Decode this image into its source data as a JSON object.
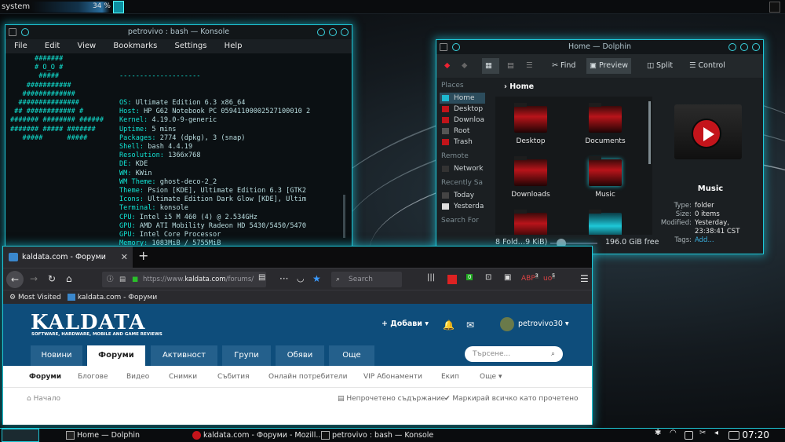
{
  "topbar": {
    "system_label": "system",
    "cpu_percent": "34 %"
  },
  "konsole": {
    "title": "petrovivo : bash — Konsole",
    "menu": [
      "File",
      "Edit",
      "View",
      "Bookmarks",
      "Settings",
      "Help"
    ],
    "logo_lines": [
      "      #######",
      "      # O_O #",
      "       #####",
      "    ###########",
      "   #############",
      "  ###############",
      " ## ############ #",
      "####### ######## ######",
      "####### ##### #######",
      "   #####      #####"
    ],
    "separator": "--------------------",
    "info": [
      {
        "k": "OS:",
        "v": "Ultimate Edition 6.3 x86_64"
      },
      {
        "k": "Host:",
        "v": "HP G62 Notebook PC 05941100002527100010 2"
      },
      {
        "k": "Kernel:",
        "v": "4.19.0-9-generic"
      },
      {
        "k": "Uptime:",
        "v": "5 mins"
      },
      {
        "k": "Packages:",
        "v": "2774 (dpkg), 3 (snap)"
      },
      {
        "k": "Shell:",
        "v": "bash 4.4.19"
      },
      {
        "k": "Resolution:",
        "v": "1366x768"
      },
      {
        "k": "DE:",
        "v": "KDE"
      },
      {
        "k": "WM:",
        "v": "KWin"
      },
      {
        "k": "WM Theme:",
        "v": "ghost-deco-2_2"
      },
      {
        "k": "Theme:",
        "v": "Psion [KDE], Ultimate Edition 6.3 [GTK2"
      },
      {
        "k": "Icons:",
        "v": "Ultimate Edition Dark Glow [KDE], Ultim"
      },
      {
        "k": "Terminal:",
        "v": "konsole"
      },
      {
        "k": "CPU:",
        "v": "Intel i5 M 460 (4) @ 2.534GHz"
      },
      {
        "k": "GPU:",
        "v": "AMD ATI Mobility Radeon HD 5430/5450/5470"
      },
      {
        "k": "GPU:",
        "v": "Intel Core Processor"
      },
      {
        "k": "Memory:",
        "v": "1083MiB / 5755MiB"
      }
    ],
    "palette": [
      "#b82a2a",
      "#2ab82a",
      "#c8a018",
      "#2a3ab8",
      "#b82ab8",
      "#18b8b8",
      "#c8c8c8"
    ]
  },
  "dolphin": {
    "title": "Home — Dolphin",
    "toolbar": {
      "find": "Find",
      "preview": "Preview",
      "split": "Split",
      "control": "Control"
    },
    "places_header": "Places",
    "places": [
      "Home",
      "Desktop",
      "Downloa",
      "Root",
      "Trash"
    ],
    "remote_header": "Remote",
    "remote": [
      "Network"
    ],
    "recent_header": "Recently Sa",
    "recent": [
      "Today",
      "Yesterda"
    ],
    "search_header": "Search For",
    "breadcrumb": "Home",
    "folders": [
      "Desktop",
      "Documents",
      "Downloads",
      "Music"
    ],
    "status_left": "8 Fold…9 KiB)",
    "status_right": "196.0 GiB free",
    "preview_name": "Music",
    "meta": [
      {
        "l": "Type:",
        "v": "folder"
      },
      {
        "l": "Size:",
        "v": "0 items"
      },
      {
        "l": "Modified:",
        "v": "Yesterday, 23:38:41 CST"
      },
      {
        "l": "Tags:",
        "v": "Add..."
      }
    ]
  },
  "firefox": {
    "tab_title": "kaldata.com - Форуми",
    "url_prefix": "https://www.",
    "url_domain": "kaldata.com",
    "url_rest": "/forums/",
    "search_placeholder": "Search",
    "bookmarks": [
      "Most Visited",
      "kaldata.com - Форуми"
    ],
    "badges": {
      "b1": "0",
      "b2": "3",
      "b3": "5"
    },
    "site": {
      "logo": "KALDATA",
      "logo_sub": "SOFTWARE, HARDWARE, MOBILE AND GAME REVIEWS",
      "add": "+ Добави ▾",
      "user": "petrovivo30 ▾",
      "tabs": [
        "Новини",
        "Форуми",
        "Активност",
        "Групи",
        "Обяви",
        "Още"
      ],
      "search_placeholder": "Търсене...",
      "subnav": [
        "Форуми",
        "Блогове",
        "Видео",
        "Снимки",
        "Събития",
        "Онлайн потребители",
        "VIP Абонаменти",
        "Екип",
        "Още ▾"
      ],
      "home_crumb": "Начало",
      "unread": "Непрочетено съдържание",
      "mark_read": "Маркирай всичко като прочетено"
    }
  },
  "taskbar": {
    "tasks": [
      "Home — Dolphin",
      "kaldata.com - Форуми - Mozill...",
      "petrovivo : bash — Konsole"
    ],
    "clock": "07:20"
  }
}
